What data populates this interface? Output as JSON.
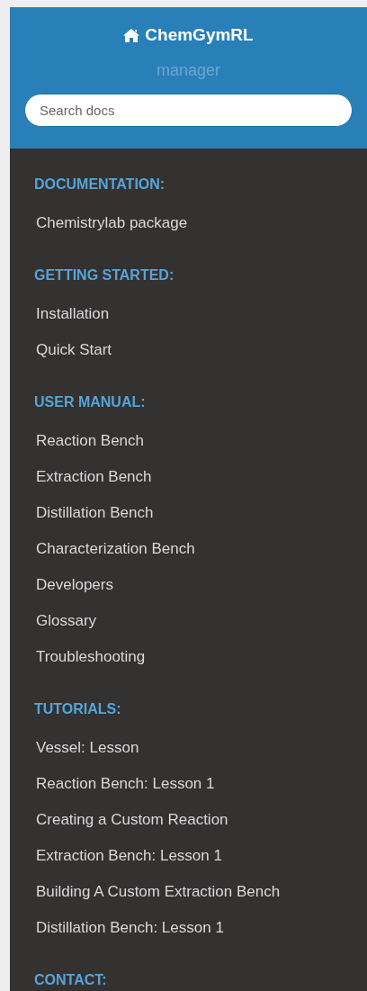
{
  "header": {
    "title": "ChemGymRL",
    "version": "manager",
    "search": {
      "placeholder": "Search docs"
    }
  },
  "sections": [
    {
      "heading": "DOCUMENTATION:",
      "items": [
        "Chemistrylab package"
      ]
    },
    {
      "heading": "GETTING STARTED:",
      "items": [
        "Installation",
        "Quick Start"
      ]
    },
    {
      "heading": "USER MANUAL:",
      "items": [
        "Reaction Bench",
        "Extraction Bench",
        "Distillation Bench",
        "Characterization Bench",
        "Developers",
        "Glossary",
        "Troubleshooting"
      ]
    },
    {
      "heading": "TUTORIALS:",
      "items": [
        "Vessel: Lesson",
        "Reaction Bench: Lesson 1",
        "Creating a Custom Reaction",
        "Extraction Bench: Lesson 1",
        "Building A Custom Extraction Bench",
        "Distillation Bench: Lesson 1"
      ]
    },
    {
      "heading": "CONTACT:"
    }
  ]
}
